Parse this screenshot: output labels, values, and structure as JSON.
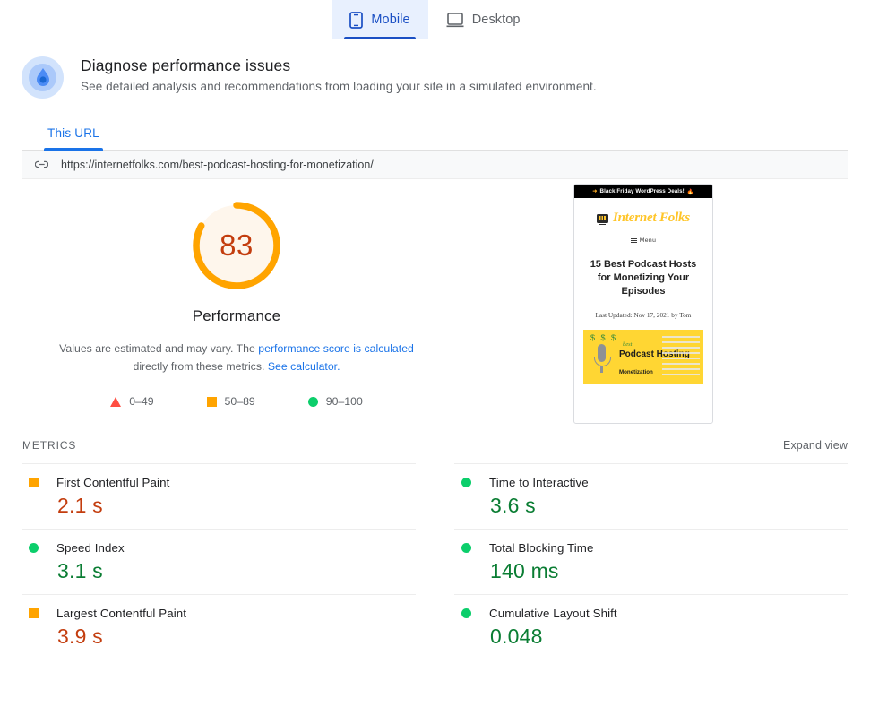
{
  "device_tabs": [
    {
      "label": "Mobile",
      "icon": "mobile-icon",
      "active": true
    },
    {
      "label": "Desktop",
      "icon": "desktop-icon",
      "active": false
    }
  ],
  "header": {
    "title": "Diagnose performance issues",
    "subtitle": "See detailed analysis and recommendations from loading your site in a simulated environment.",
    "icon": "lighthouse-icon"
  },
  "url_section": {
    "tab_label": "This URL",
    "link_icon": "link-icon",
    "url": "https://internetfolks.com/best-podcast-hosting-for-monetization/"
  },
  "score": {
    "value": "83",
    "value_number": 83,
    "label": "Performance",
    "arc_color": "#ffa400",
    "text_color": "#c33d0e",
    "track_color": "#fef6ec",
    "note_part1": "Values are estimated and may vary. The ",
    "note_link1": "performance score is calculated",
    "note_part2": " directly from these metrics. ",
    "note_link2": "See calculator.",
    "legend": [
      {
        "marker": "triangle",
        "color": "#ff4e42",
        "range": "0–49"
      },
      {
        "marker": "square",
        "color": "#ffa400",
        "range": "50–89"
      },
      {
        "marker": "circle",
        "color": "#0cce6b",
        "range": "90–100"
      }
    ]
  },
  "screenshot_preview": {
    "banner_text": "Black Friday WordPress Deals!",
    "banner_emoji": "🔥",
    "banner_arrow": "➜",
    "site_name": "Internet Folks",
    "menu_label": "Menu",
    "headline": "15 Best Podcast Hosts for Monetizing Your Episodes",
    "byline": "Last Updated: Nov 17, 2021 by Tom",
    "image_cash": "$ $ $",
    "image_best": "best",
    "image_title": "Podcast Hosting",
    "image_sub": "Monetization"
  },
  "metrics_section": {
    "heading": "METRICS",
    "expand_label": "Expand view",
    "items": [
      {
        "name": "First Contentful Paint",
        "value": "2.1 s",
        "status": "average",
        "marker": "square",
        "column": "left"
      },
      {
        "name": "Time to Interactive",
        "value": "3.6 s",
        "status": "good",
        "marker": "circle",
        "column": "right"
      },
      {
        "name": "Speed Index",
        "value": "3.1 s",
        "status": "good",
        "marker": "circle",
        "column": "left"
      },
      {
        "name": "Total Blocking Time",
        "value": "140 ms",
        "status": "good",
        "marker": "circle",
        "column": "right"
      },
      {
        "name": "Largest Contentful Paint",
        "value": "3.9 s",
        "status": "average",
        "marker": "square",
        "column": "left"
      },
      {
        "name": "Cumulative Layout Shift",
        "value": "0.048",
        "status": "good",
        "marker": "circle",
        "column": "right"
      }
    ]
  }
}
